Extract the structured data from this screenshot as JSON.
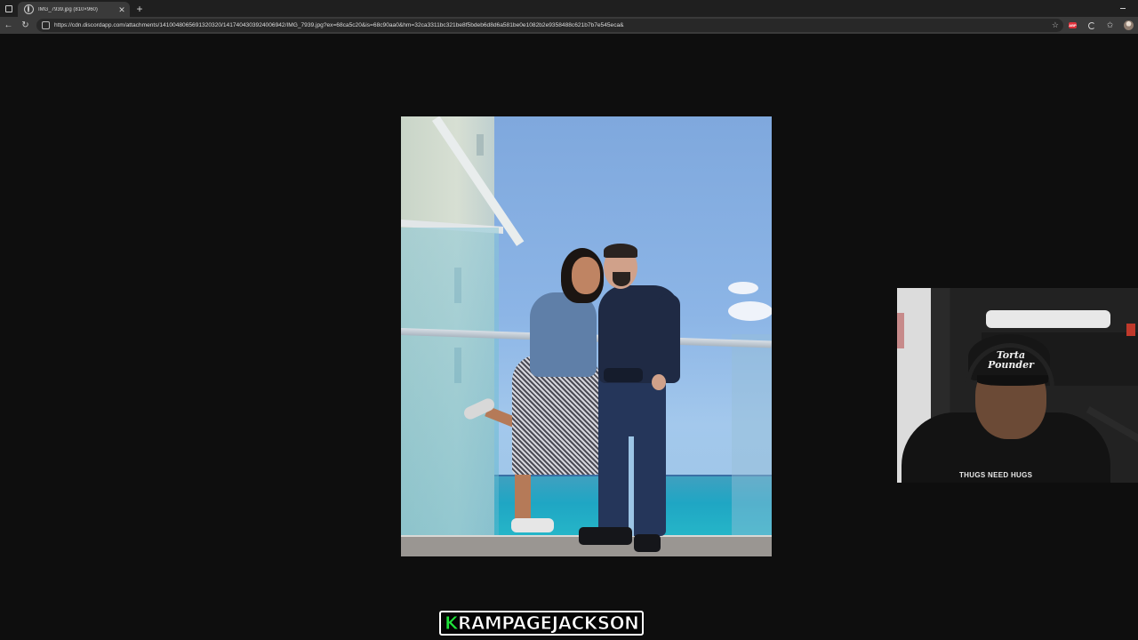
{
  "browser": {
    "tab": {
      "title": "IMG_7939.jpg (810×960)"
    },
    "new_tab_symbol": "+",
    "url": "https://cdn.discordapp.com/attachments/1410048065691320320/1417404303924006942/IMG_7939.jpg?ex=68ca5c20&is=68c90aa0&hm=32ca3311bc321be8f5bdeb6d8d6a581be0e1082b2e9358488c621b7b7e545eca&",
    "extension_badge": "ABP"
  },
  "webcam": {
    "cap_text": "Torta Pounder",
    "shirt_text": "THUGS NEED HUGS"
  },
  "streamer": {
    "first_letter": "K",
    "rest": "RAMPAGEJACKSON"
  }
}
